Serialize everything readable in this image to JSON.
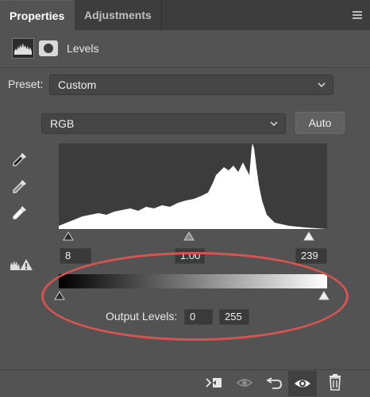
{
  "tabs": [
    {
      "label": "Properties",
      "active": true
    },
    {
      "label": "Adjustments",
      "active": false
    }
  ],
  "header": {
    "title": "Levels"
  },
  "preset": {
    "label": "Preset:",
    "value": "Custom"
  },
  "channel": {
    "value": "RGB"
  },
  "auto_button": {
    "label": "Auto"
  },
  "input_levels": {
    "black": "8",
    "gamma": "1.00",
    "white": "239"
  },
  "output": {
    "label": "Output Levels:",
    "black": "0",
    "white": "255"
  },
  "icons": {
    "panel_menu": "hamburger-menu-icon",
    "adjustment": "histogram-icon",
    "mask": "mask-icon",
    "eyedroppers": [
      "black-point-eyedropper-icon",
      "gray-point-eyedropper-icon",
      "white-point-eyedropper-icon"
    ],
    "bottom": [
      "clip-to-layer-icon",
      "view-previous-state-icon",
      "reset-icon",
      "visibility-eye-icon",
      "trash-icon"
    ]
  },
  "colors": {
    "annotation_oval": "#d9534f",
    "panel_bg": "#535353"
  }
}
